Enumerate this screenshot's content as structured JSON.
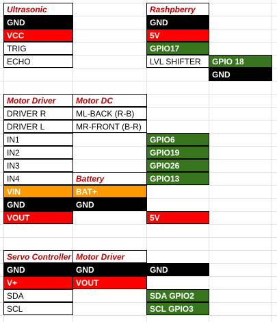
{
  "colors": {
    "black": "#000000",
    "red": "#ff0000",
    "green": "#38761d",
    "orange": "#ff9900",
    "header_text": "#c00000"
  },
  "ultrasonic": {
    "header": "Ultrasonic",
    "gnd": "GND",
    "vcc": "VCC",
    "trig": "TRIG",
    "echo": "ECHO"
  },
  "raspberry": {
    "header": "Rashpberry",
    "gnd": "GND",
    "v5": "5V",
    "gpio17": "GPIO17",
    "lvl_shifter": "LVL SHIFTER",
    "gpio18": "GPIO 18",
    "gnd2": "GND"
  },
  "motor_section": {
    "driver_header": "Motor Driver",
    "dc_header": "Motor DC",
    "driver_r": "DRIVER R",
    "ml_back": "ML-BACK (R-B)",
    "driver_l": "DRIVER L",
    "mr_front": "MR-FRONT (B-R)",
    "in1": "IN1",
    "gpio6": "GPIO6",
    "in2": "IN2",
    "gpio19": "GPIO19",
    "in3": "IN3",
    "gpio26": "GPIO26",
    "in4": "IN4",
    "battery_header": "Battery",
    "gpio13": "GPIO13",
    "vin": "VIN",
    "bat_plus": "BAT+",
    "gnd": "GND",
    "gnd_bat": "GND",
    "vout": "VOUT",
    "v5": "5V"
  },
  "servo_section": {
    "servo_header": "Servo Controller",
    "driver_header": "Motor Driver",
    "gnd": "GND",
    "gnd_driver": "GND",
    "gnd_pi": "GND",
    "vplus": "V+",
    "vout": "VOUT",
    "sda": "SDA",
    "sda_gpio": "SDA GPIO2",
    "scl": "SCL",
    "scl_gpio": "SCL GPIO3"
  }
}
